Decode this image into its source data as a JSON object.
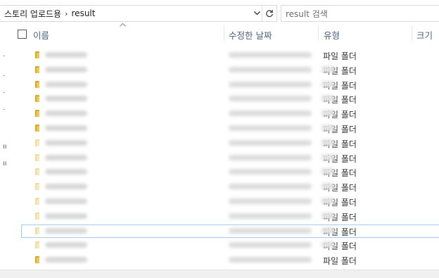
{
  "address_bar": {
    "crumbs": [
      "스토리 업로드용",
      "result"
    ],
    "separator_icon": "chevron-right-icon",
    "dropdown_icon": "chevron-down-icon",
    "refresh_icon": "refresh-icon"
  },
  "search": {
    "placeholder": "result 검색"
  },
  "columns": {
    "name": "이름",
    "date_modified": "수정한 날짜",
    "type": "유형",
    "size": "크기"
  },
  "sort_indicator_icon": "sort-up-icon",
  "folder_icon": "folder-icon",
  "rows": [
    {
      "type": "파일 폴더",
      "selected": false
    },
    {
      "type": "파일 폴더",
      "selected": false
    },
    {
      "type": "파일 폴더",
      "selected": false
    },
    {
      "type": "파일 폴더",
      "selected": false
    },
    {
      "type": "파일 폴더",
      "selected": false
    },
    {
      "type": "파일 폴더",
      "selected": false
    },
    {
      "type": "파일 폴더",
      "selected": false
    },
    {
      "type": "파일 폴더",
      "selected": false
    },
    {
      "type": "파일 폴더",
      "selected": false
    },
    {
      "type": "파일 폴더",
      "selected": false
    },
    {
      "type": "파일 폴더",
      "selected": false
    },
    {
      "type": "파일 폴더",
      "selected": false
    },
    {
      "type": "파일 폴더",
      "selected": true
    },
    {
      "type": "파일 폴더",
      "selected": false
    },
    {
      "type": "파일 폴더",
      "selected": false
    }
  ],
  "colors": {
    "header_text": "#4a5f7f",
    "selection_border": "#a9c9e9",
    "folder": "#f2c94c"
  }
}
